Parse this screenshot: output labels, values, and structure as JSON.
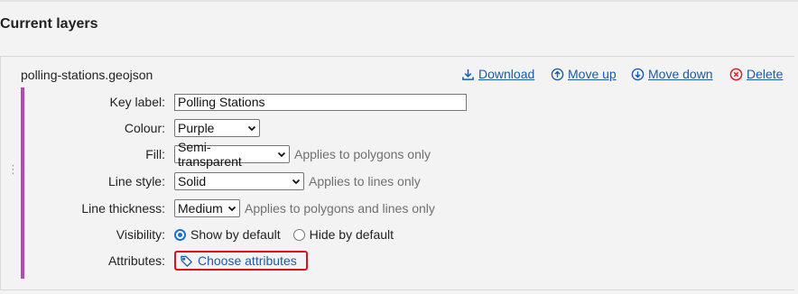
{
  "section": {
    "title": "Current layers"
  },
  "layer": {
    "name": "polling-stations.geojson",
    "actions": {
      "download": "Download",
      "move_up": "Move up",
      "move_down": "Move down",
      "delete": "Delete"
    },
    "fields": {
      "key_label": {
        "label": "Key label:",
        "value": "Polling Stations"
      },
      "colour": {
        "label": "Colour:",
        "value": "Purple"
      },
      "fill": {
        "label": "Fill:",
        "value": "Semi-transparent",
        "hint": "Applies to polygons only"
      },
      "line_style": {
        "label": "Line style:",
        "value": "Solid",
        "hint": "Applies to lines only"
      },
      "line_thickness": {
        "label": "Line thickness:",
        "value": "Medium",
        "hint": "Applies to polygons and lines only"
      },
      "visibility": {
        "label": "Visibility:",
        "options": [
          "Show by default",
          "Hide by default"
        ],
        "selected": "Show by default"
      },
      "attributes": {
        "label": "Attributes:",
        "link": "Choose attributes"
      }
    }
  },
  "colors": {
    "accent": "#b04bb2",
    "link": "#1b5ba8",
    "delete_icon": "#d9202a",
    "highlight": "#e0101a"
  }
}
